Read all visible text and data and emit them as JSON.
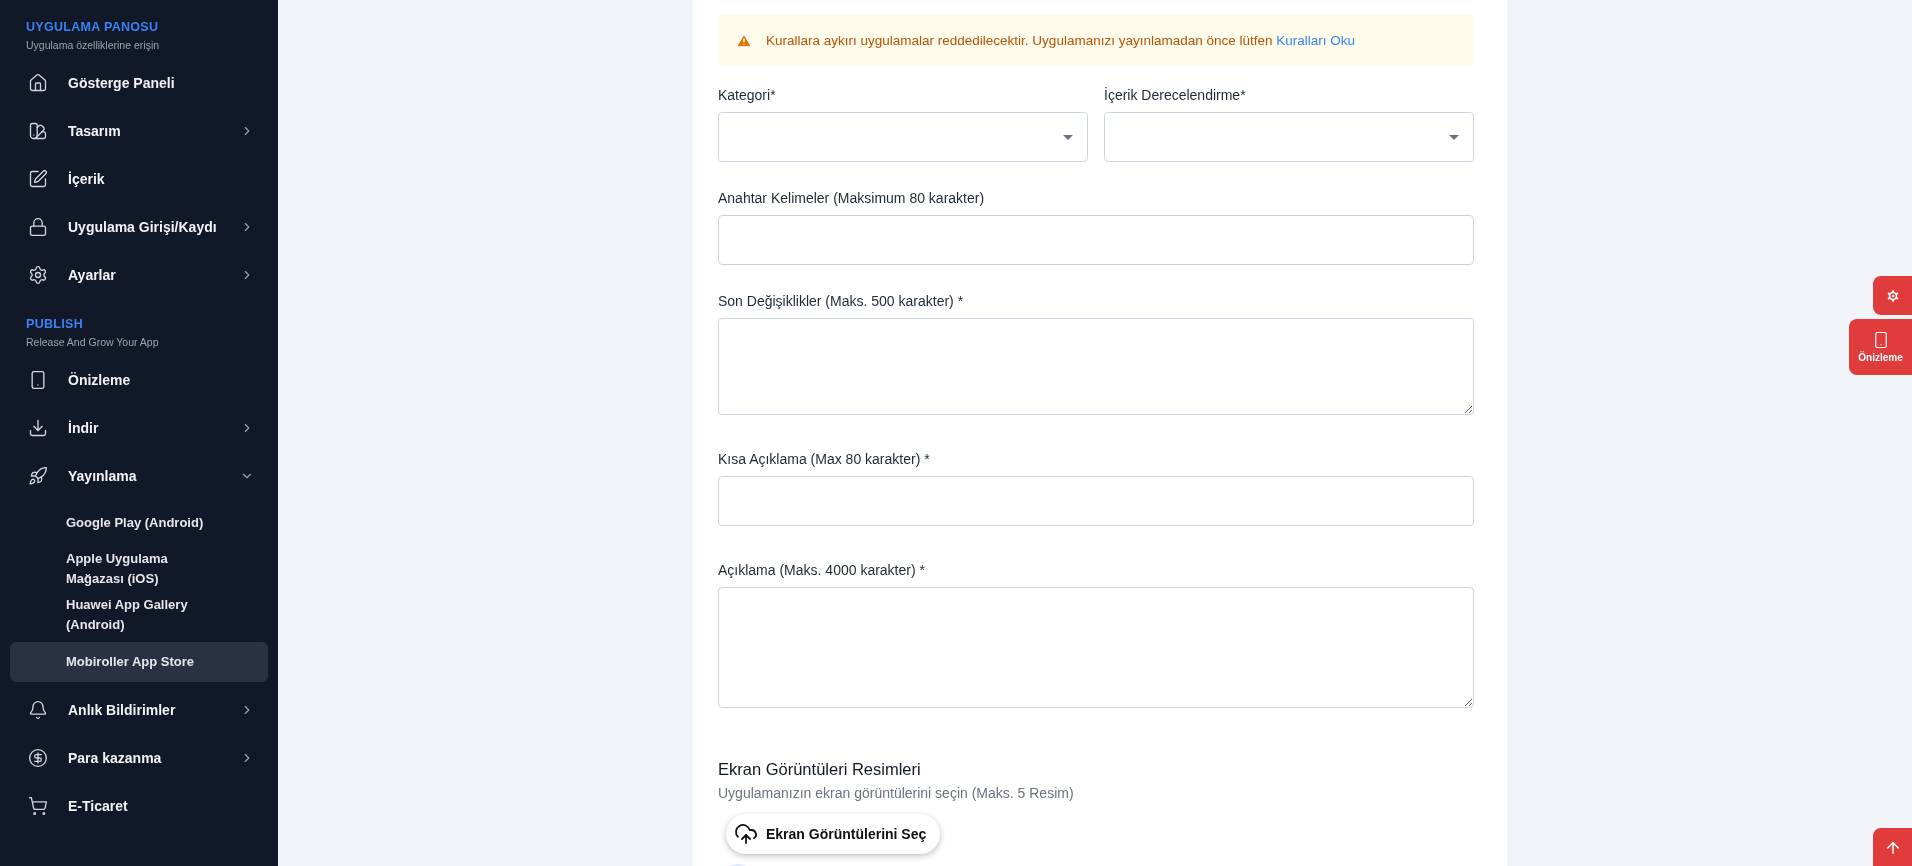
{
  "sidebar": {
    "sections": [
      {
        "title": "UYGULAMA PANOSU",
        "subtitle": "Uygulama özelliklerine erişin",
        "items": [
          {
            "label": "Gösterge Paneli"
          },
          {
            "label": "Tasarım",
            "expanded": false
          },
          {
            "label": "İçerik"
          },
          {
            "label": "Uygulama Girişi/Kaydı",
            "expanded": false
          },
          {
            "label": "Ayarlar",
            "expanded": false
          }
        ]
      },
      {
        "title": "PUBLISH",
        "subtitle": "Release And Grow Your App",
        "items": [
          {
            "label": "Önizleme"
          },
          {
            "label": "İndir",
            "expanded": false
          },
          {
            "label": "Yayınlama",
            "expanded": true,
            "children": [
              {
                "label": "Google Play (Android)",
                "selected": false
              },
              {
                "label": "Apple Uygulama Mağazası (iOS)",
                "selected": false
              },
              {
                "label": "Huawei App Gallery (Android)",
                "selected": false
              },
              {
                "label": "Mobiroller App Store",
                "selected": true
              }
            ]
          },
          {
            "label": "Anlık Bildirimler",
            "expanded": false
          },
          {
            "label": "Para kazanma",
            "expanded": false
          },
          {
            "label": "E-Ticaret"
          }
        ]
      }
    ]
  },
  "alert": {
    "text": "Kurallara aykırı uygulamalar reddedilecektir. Uygulamanızı yayınlamadan önce lütfen",
    "link": "Kuralları Oku"
  },
  "form_rows": [
    [
      {
        "kind": "select",
        "label": "Kategori*"
      },
      {
        "kind": "select",
        "label": "İçerik Derecelendirme*"
      }
    ],
    [
      {
        "kind": "input",
        "label": "Anahtar Kelimeler (Maksimum 80 karakter)"
      }
    ],
    [
      {
        "kind": "textarea",
        "label": "Son Değişiklikler (Maks. 500 karakter) *"
      }
    ],
    [
      {
        "kind": "input",
        "label": "Kısa Açıklama (Max 80 karakter) *"
      }
    ],
    [
      {
        "kind": "textarea",
        "label": "Açıklama (Maks. 4000 karakter) *"
      }
    ]
  ],
  "screenshots": {
    "title": "Ekran Görüntüleri Resimleri",
    "subtitle": "Uygulamanızın ekran görüntülerini seçin (Maks. 5 Resim)",
    "button": "Ekran Görüntülerini Seç"
  },
  "floating": {
    "preview_label": "Önizleme"
  }
}
